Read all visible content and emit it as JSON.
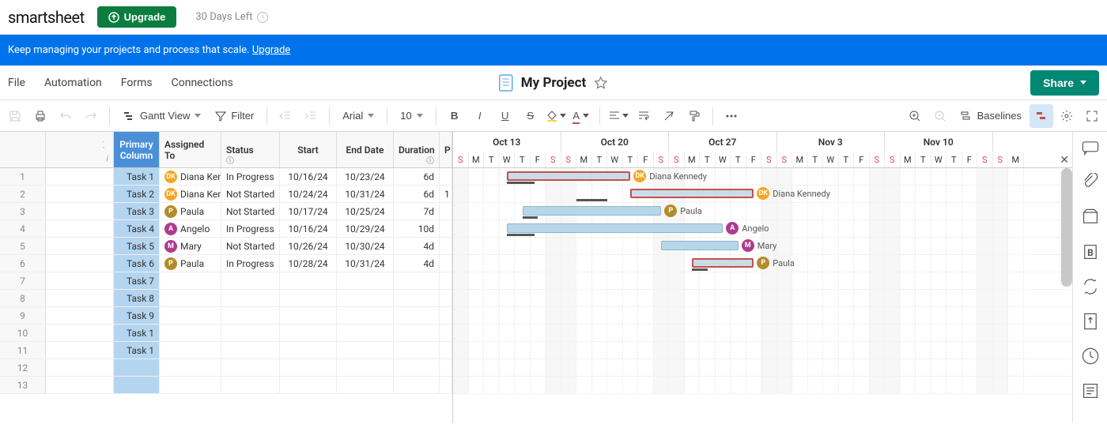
{
  "header": {
    "logo": "smartsheet",
    "upgrade": "Upgrade",
    "days_left": "30 Days Left"
  },
  "banner": {
    "text_a": "Keep managing your projects and process that scale. ",
    "link": "Upgrade"
  },
  "menubar": {
    "file": "File",
    "automation": "Automation",
    "forms": "Forms",
    "connections": "Connections",
    "title": "My Project",
    "share": "Share"
  },
  "toolbar": {
    "view": "Gantt View",
    "filter": "Filter",
    "font": "Arial",
    "size": "10",
    "baselines": "Baselines"
  },
  "columns": {
    "primary": "Primary Column",
    "assigned": "Assigned To",
    "status": "Status",
    "start": "Start",
    "end": "End Date",
    "duration": "Duration",
    "p": "P"
  },
  "assignees": {
    "diana": {
      "initials": "DK",
      "name": "Diana Kennedy",
      "short": "Diana Ken",
      "color": "#f5a623"
    },
    "paula": {
      "initials": "P",
      "name": "Paula",
      "color": "#b58b2a"
    },
    "angelo": {
      "initials": "A",
      "name": "Angelo",
      "color": "#b03a8f"
    },
    "mary": {
      "initials": "M",
      "name": "Mary",
      "color": "#b03a8f"
    }
  },
  "rows": [
    {
      "n": 1,
      "task": "Task 1",
      "assignee": "diana",
      "status": "In Progress",
      "start": "10/16/24",
      "end": "10/23/24",
      "dur": "6d",
      "p": "",
      "bar_start": 3.5,
      "bar_len": 8,
      "red": true,
      "baseline_start": 3.5,
      "baseline_len": 1.8
    },
    {
      "n": 2,
      "task": "Task 2",
      "assignee": "diana",
      "status": "Not Started",
      "start": "10/24/24",
      "end": "10/31/24",
      "dur": "6d",
      "p": "1",
      "bar_start": 11.5,
      "bar_len": 8,
      "red": true,
      "baseline_start": 8,
      "baseline_len": 2
    },
    {
      "n": 3,
      "task": "Task 3",
      "assignee": "paula",
      "status": "Not Started",
      "start": "10/17/24",
      "end": "10/25/24",
      "dur": "7d",
      "p": "",
      "bar_start": 4.5,
      "bar_len": 9,
      "red": false,
      "baseline_start": 4.5,
      "baseline_len": 1
    },
    {
      "n": 4,
      "task": "Task 4",
      "assignee": "angelo",
      "status": "In Progress",
      "start": "10/16/24",
      "end": "10/29/24",
      "dur": "10d",
      "p": "",
      "bar_start": 3.5,
      "bar_len": 14,
      "red": false,
      "baseline_start": 3.5,
      "baseline_len": 1.8
    },
    {
      "n": 5,
      "task": "Task 5",
      "assignee": "mary",
      "status": "Not Started",
      "start": "10/26/24",
      "end": "10/30/24",
      "dur": "4d",
      "p": "",
      "bar_start": 13.5,
      "bar_len": 5,
      "red": false
    },
    {
      "n": 6,
      "task": "Task 6",
      "assignee": "paula",
      "status": "In Progress",
      "start": "10/28/24",
      "end": "10/31/24",
      "dur": "4d",
      "p": "",
      "bar_start": 15.5,
      "bar_len": 4,
      "red": true,
      "baseline_start": 15.5,
      "baseline_len": 1
    },
    {
      "n": 7,
      "task": "Task 7"
    },
    {
      "n": 8,
      "task": "Task 8"
    },
    {
      "n": 9,
      "task": "Task 9"
    },
    {
      "n": 10,
      "task": "Task 1"
    },
    {
      "n": 11,
      "task": "Task 1"
    },
    {
      "n": 12,
      "task": ""
    },
    {
      "n": 13,
      "task": ""
    }
  ],
  "gantt": {
    "day_width": 19.5,
    "weeks": [
      "Oct 13",
      "Oct 20",
      "Oct 27",
      "Nov 3",
      "Nov 10"
    ],
    "days": [
      "S",
      "M",
      "T",
      "W",
      "T",
      "F",
      "S",
      "S",
      "M",
      "T",
      "W",
      "T",
      "F",
      "S",
      "S",
      "M",
      "T",
      "W",
      "T",
      "F",
      "S",
      "S",
      "M",
      "T",
      "W",
      "T",
      "F",
      "S",
      "S",
      "M",
      "T",
      "W",
      "T",
      "F",
      "S",
      "S",
      "M"
    ],
    "weekend_idx": [
      0,
      6,
      7,
      13,
      14,
      20,
      21,
      27,
      28,
      34,
      35
    ]
  }
}
